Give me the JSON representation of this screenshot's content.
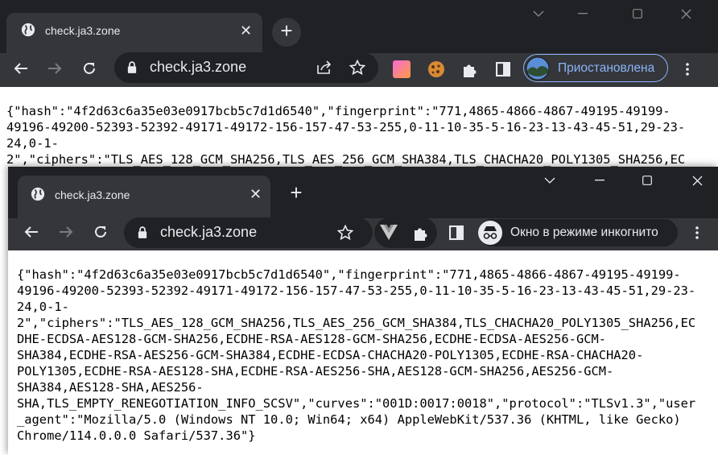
{
  "back_window": {
    "tab": {
      "title": "check.ja3.zone",
      "close_glyph": "✕"
    },
    "newtab_glyph": "+",
    "controls": {
      "minimize_glyph": "—",
      "maximize_glyph": "☐",
      "close_glyph": "✕"
    },
    "omnibox": {
      "url": "check.ja3.zone"
    },
    "profile": {
      "label": "Приостановлена"
    },
    "content_lines": [
      "{\"hash\":\"4f2d63c6a35e03e0917bcb5c7d1d6540\",\"fingerprint\":\"771,4865-4866-4867-49195-49199-",
      "49196-49200-52393-52392-49171-49172-156-157-47-53-255,0-11-10-35-5-16-23-13-43-45-51,29-23-",
      "24,0-1-",
      "2\",\"ciphers\":\"TLS_AES_128_GCM_SHA256,TLS_AES_256_GCM_SHA384,TLS_CHACHA20_POLY1305_SHA256,EC"
    ]
  },
  "front_window": {
    "tab": {
      "title": "check.ja3.zone",
      "close_glyph": "✕"
    },
    "newtab_glyph": "+",
    "controls": {
      "menu_glyph": "⌄",
      "minimize_glyph": "—",
      "maximize_glyph": "☐",
      "close_glyph": "✕"
    },
    "omnibox": {
      "url": "check.ja3.zone"
    },
    "incognito": {
      "label": "Окно в режиме инкогнито"
    },
    "content_lines": [
      "{\"hash\":\"4f2d63c6a35e03e0917bcb5c7d1d6540\",\"fingerprint\":\"771,4865-4866-4867-49195-49199-",
      "49196-49200-52393-52392-49171-49172-156-157-47-53-255,0-11-10-35-5-16-23-13-43-45-51,29-23-",
      "24,0-1-",
      "2\",\"ciphers\":\"TLS_AES_128_GCM_SHA256,TLS_AES_256_GCM_SHA384,TLS_CHACHA20_POLY1305_SHA256,EC",
      "DHE-ECDSA-AES128-GCM-SHA256,ECDHE-RSA-AES128-GCM-SHA256,ECDHE-ECDSA-AES256-GCM-",
      "SHA384,ECDHE-RSA-AES256-GCM-SHA384,ECDHE-ECDSA-CHACHA20-POLY1305,ECDHE-RSA-CHACHA20-",
      "POLY1305,ECDHE-RSA-AES128-SHA,ECDHE-RSA-AES256-SHA,AES128-GCM-SHA256,AES256-GCM-",
      "SHA384,AES128-SHA,AES256-",
      "SHA,TLS_EMPTY_RENEGOTIATION_INFO_SCSV\",\"curves\":\"001D:0017:0018\",\"protocol\":\"TLSv1.3\",\"user",
      "_agent\":\"Mozilla/5.0 (Windows NT 10.0; Win64; x64) AppleWebKit/537.36 (KHTML, like Gecko)",
      "Chrome/114.0.0.0 Safari/537.36\"}"
    ]
  },
  "colors": {
    "tabstrip": "#202124",
    "toolbar": "#35363a",
    "omnibox": "#202124",
    "profile_accent": "#8ab4f8"
  },
  "icons": [
    "globe-icon",
    "close-icon",
    "plus-icon",
    "back-arrow-icon",
    "forward-arrow-icon",
    "reload-icon",
    "lock-icon",
    "share-icon",
    "star-icon",
    "extension-icon",
    "cookie-icon",
    "puzzle-icon",
    "sidepanel-icon",
    "avatar-icon",
    "kebab-menu-icon",
    "chevron-down-icon",
    "minimize-icon",
    "maximize-icon",
    "incognito-icon",
    "vuejs-icon"
  ]
}
